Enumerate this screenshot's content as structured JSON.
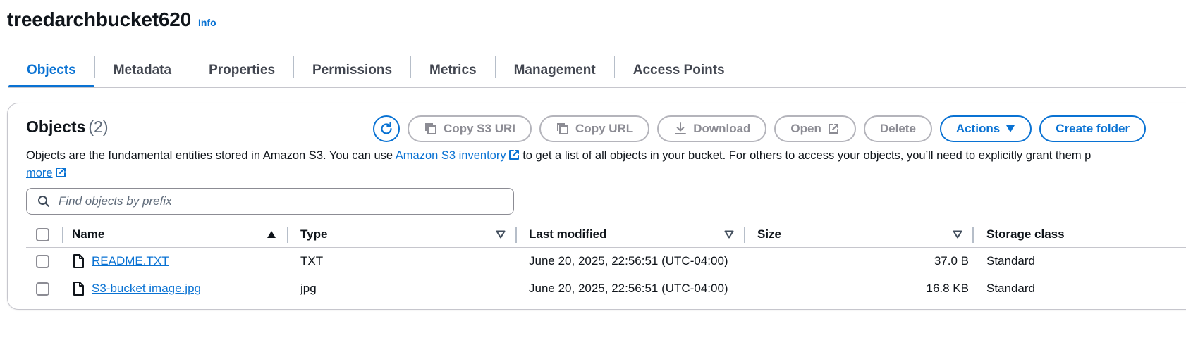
{
  "bucket": {
    "title": "treedarchbucket620",
    "info_label": "Info"
  },
  "tabs": [
    {
      "label": "Objects",
      "active": true
    },
    {
      "label": "Metadata"
    },
    {
      "label": "Properties"
    },
    {
      "label": "Permissions"
    },
    {
      "label": "Metrics"
    },
    {
      "label": "Management"
    },
    {
      "label": "Access Points"
    }
  ],
  "objects_panel": {
    "title": "Objects",
    "count": "(2)",
    "buttons": {
      "refresh_icon": "refresh-icon",
      "copy_s3_uri": "Copy S3 URI",
      "copy_url": "Copy URL",
      "download": "Download",
      "open": "Open",
      "delete": "Delete",
      "actions": "Actions",
      "create_folder": "Create folder"
    },
    "description": {
      "text_before": "Objects are the fundamental entities stored in Amazon S3. You can use ",
      "link_inventory": "Amazon S3 inventory",
      "text_after": " to get a list of all objects in your bucket. For others to access your objects, you’ll need to explicitly grant them p",
      "link_more": "more"
    },
    "search": {
      "placeholder": "Find objects by prefix",
      "value": ""
    },
    "table": {
      "columns": [
        "Name",
        "Type",
        "Last modified",
        "Size",
        "Storage class"
      ],
      "rows": [
        {
          "name": "README.TXT",
          "type": "TXT",
          "last_modified": "June 20, 2025, 22:56:51 (UTC-04:00)",
          "size": "37.0 B",
          "storage_class": "Standard"
        },
        {
          "name": "S3-bucket image.jpg",
          "type": "jpg",
          "last_modified": "June 20, 2025, 22:56:51 (UTC-04:00)",
          "size": "16.8 KB",
          "storage_class": "Standard"
        }
      ]
    }
  },
  "colors": {
    "accent": "#0972d3",
    "text": "#0f141a",
    "disabled": "#8c8c94",
    "border": "#c6c6cd"
  }
}
